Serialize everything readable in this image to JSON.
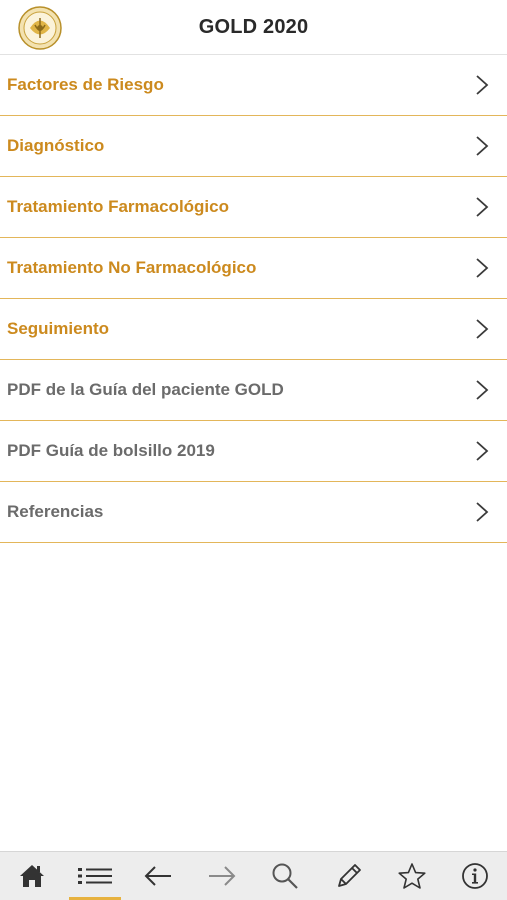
{
  "header": {
    "title": "GOLD 2020",
    "logo_icon": "gold-emblem-icon"
  },
  "colors": {
    "accent_text": "#cc8a1e",
    "muted_text": "#6b6b6b",
    "divider": "#e3b65a",
    "toolbar_bg": "#ededed",
    "active_tab_indicator": "#e7b23f"
  },
  "menu": {
    "items": [
      {
        "label": "Factores de Riesgo"
      },
      {
        "label": "Diagnóstico"
      },
      {
        "label": "Tratamiento Farmacológico"
      },
      {
        "label": "Tratamiento No Farmacológico"
      },
      {
        "label": "Seguimiento"
      },
      {
        "label": "PDF de la Guía del paciente GOLD"
      },
      {
        "label": "PDF Guía de bolsillo 2019"
      },
      {
        "label": "Referencias"
      }
    ]
  },
  "toolbar": {
    "items": [
      {
        "icon": "home-icon"
      },
      {
        "icon": "list-icon",
        "active": true
      },
      {
        "icon": "arrow-left-icon"
      },
      {
        "icon": "arrow-right-icon"
      },
      {
        "icon": "search-icon"
      },
      {
        "icon": "pencil-icon"
      },
      {
        "icon": "star-icon"
      },
      {
        "icon": "info-icon"
      }
    ]
  }
}
